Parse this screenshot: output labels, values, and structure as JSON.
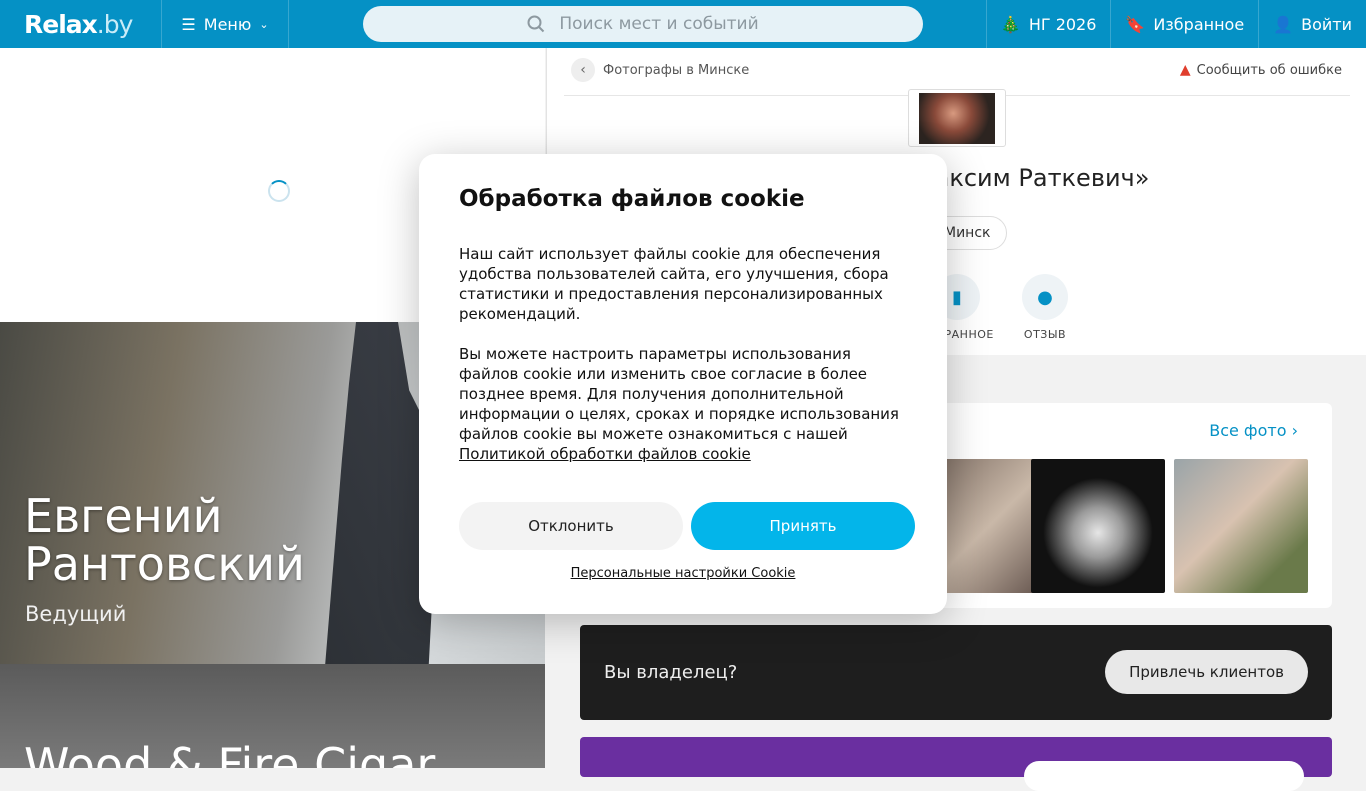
{
  "header": {
    "logo": "Relax",
    "logo_suffix": ".by",
    "menu_label": "Меню",
    "search_placeholder": "Поиск мест и событий",
    "ny_label": "НГ 2026",
    "favorites_label": "Избранное",
    "login_label": "Войти"
  },
  "left": {
    "promo1_name": "Евгений Рантовский",
    "promo1_role": "Ведущий",
    "promo2_name": "Wood & Fire Cigar"
  },
  "page": {
    "breadcrumb": "Фотографы в Минске",
    "report": "Сообщить об ошибке",
    "title": "Фотограф «Максим Раткевич»",
    "city": "Минск",
    "actions": [
      {
        "label": "ИЗБРАННОЕ",
        "icon": "bookmark-icon"
      },
      {
        "label": "ОТЗЫВ",
        "icon": "chat-icon"
      }
    ],
    "all_photos": "Все фото",
    "owner_question": "Вы владелец?",
    "owner_button": "Привлечь клиентов"
  },
  "cookie": {
    "title": "Обработка файлов cookie",
    "p1": "Наш сайт использует файлы cookie для обеспечения удобства пользователей сайта, его улучшения, сбора статистики и предоставления персонализированных рекомендаций.",
    "p2": "Вы можете настроить параметры использования файлов cookie или изменить свое согласие в более позднее время. Для получения дополнительной информации о целях, сроках и порядке использования файлов cookie вы можете ознакомиться с нашей",
    "policy_link": "Политикой обработки файлов cookie",
    "decline": "Отклонить",
    "accept": "Принять",
    "personal": "Персональные настройки Cookie"
  },
  "colors": {
    "brand": "#0591c5",
    "accept": "#03b5ea"
  }
}
